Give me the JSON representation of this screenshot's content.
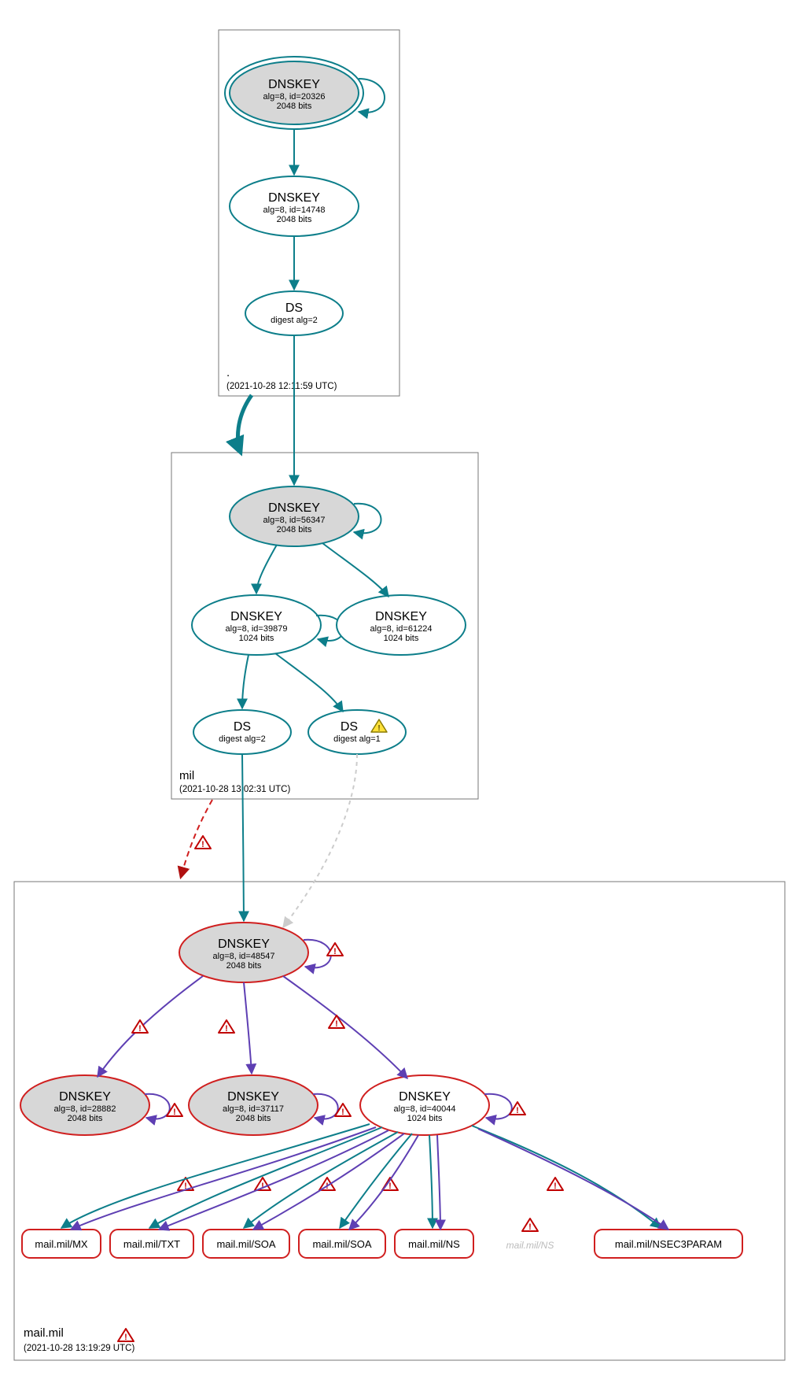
{
  "colors": {
    "teal": "#0d7e8a",
    "purple": "#5e3fb3",
    "red": "#d01f1f",
    "gray": "#cccccc",
    "fill_gray": "#d7d7d7"
  },
  "zones": {
    "root": {
      "label": ".",
      "timestamp": "(2021-10-28 12:11:59 UTC)"
    },
    "mil": {
      "label": "mil",
      "timestamp": "(2021-10-28 13:02:31 UTC)"
    },
    "mailmil": {
      "label": "mail.mil",
      "timestamp": "(2021-10-28 13:19:29 UTC)"
    }
  },
  "nodes": {
    "root_ksk": {
      "title": "DNSKEY",
      "l1": "alg=8, id=20326",
      "l2": "2048 bits"
    },
    "root_zsk": {
      "title": "DNSKEY",
      "l1": "alg=8, id=14748",
      "l2": "2048 bits"
    },
    "root_ds": {
      "title": "DS",
      "l1": "digest alg=2",
      "l2": ""
    },
    "mil_ksk": {
      "title": "DNSKEY",
      "l1": "alg=8, id=56347",
      "l2": "2048 bits"
    },
    "mil_zsk1": {
      "title": "DNSKEY",
      "l1": "alg=8, id=39879",
      "l2": "1024 bits"
    },
    "mil_zsk2": {
      "title": "DNSKEY",
      "l1": "alg=8, id=61224",
      "l2": "1024 bits"
    },
    "mil_ds1": {
      "title": "DS",
      "l1": "digest alg=2",
      "l2": ""
    },
    "mil_ds2": {
      "title": "DS",
      "l1": "digest alg=1",
      "l2": ""
    },
    "mm_ksk": {
      "title": "DNSKEY",
      "l1": "alg=8, id=48547",
      "l2": "2048 bits"
    },
    "mm_k1": {
      "title": "DNSKEY",
      "l1": "alg=8, id=28882",
      "l2": "2048 bits"
    },
    "mm_k2": {
      "title": "DNSKEY",
      "l1": "alg=8, id=37117",
      "l2": "2048 bits"
    },
    "mm_k3": {
      "title": "DNSKEY",
      "l1": "alg=8, id=40044",
      "l2": "1024 bits"
    },
    "rr_mx": {
      "label": "mail.mil/MX"
    },
    "rr_txt": {
      "label": "mail.mil/TXT"
    },
    "rr_soa1": {
      "label": "mail.mil/SOA"
    },
    "rr_soa2": {
      "label": "mail.mil/SOA"
    },
    "rr_ns": {
      "label": "mail.mil/NS"
    },
    "rr_ns_ghost": {
      "label": "mail.mil/NS"
    },
    "rr_nsec3": {
      "label": "mail.mil/NSEC3PARAM"
    }
  }
}
